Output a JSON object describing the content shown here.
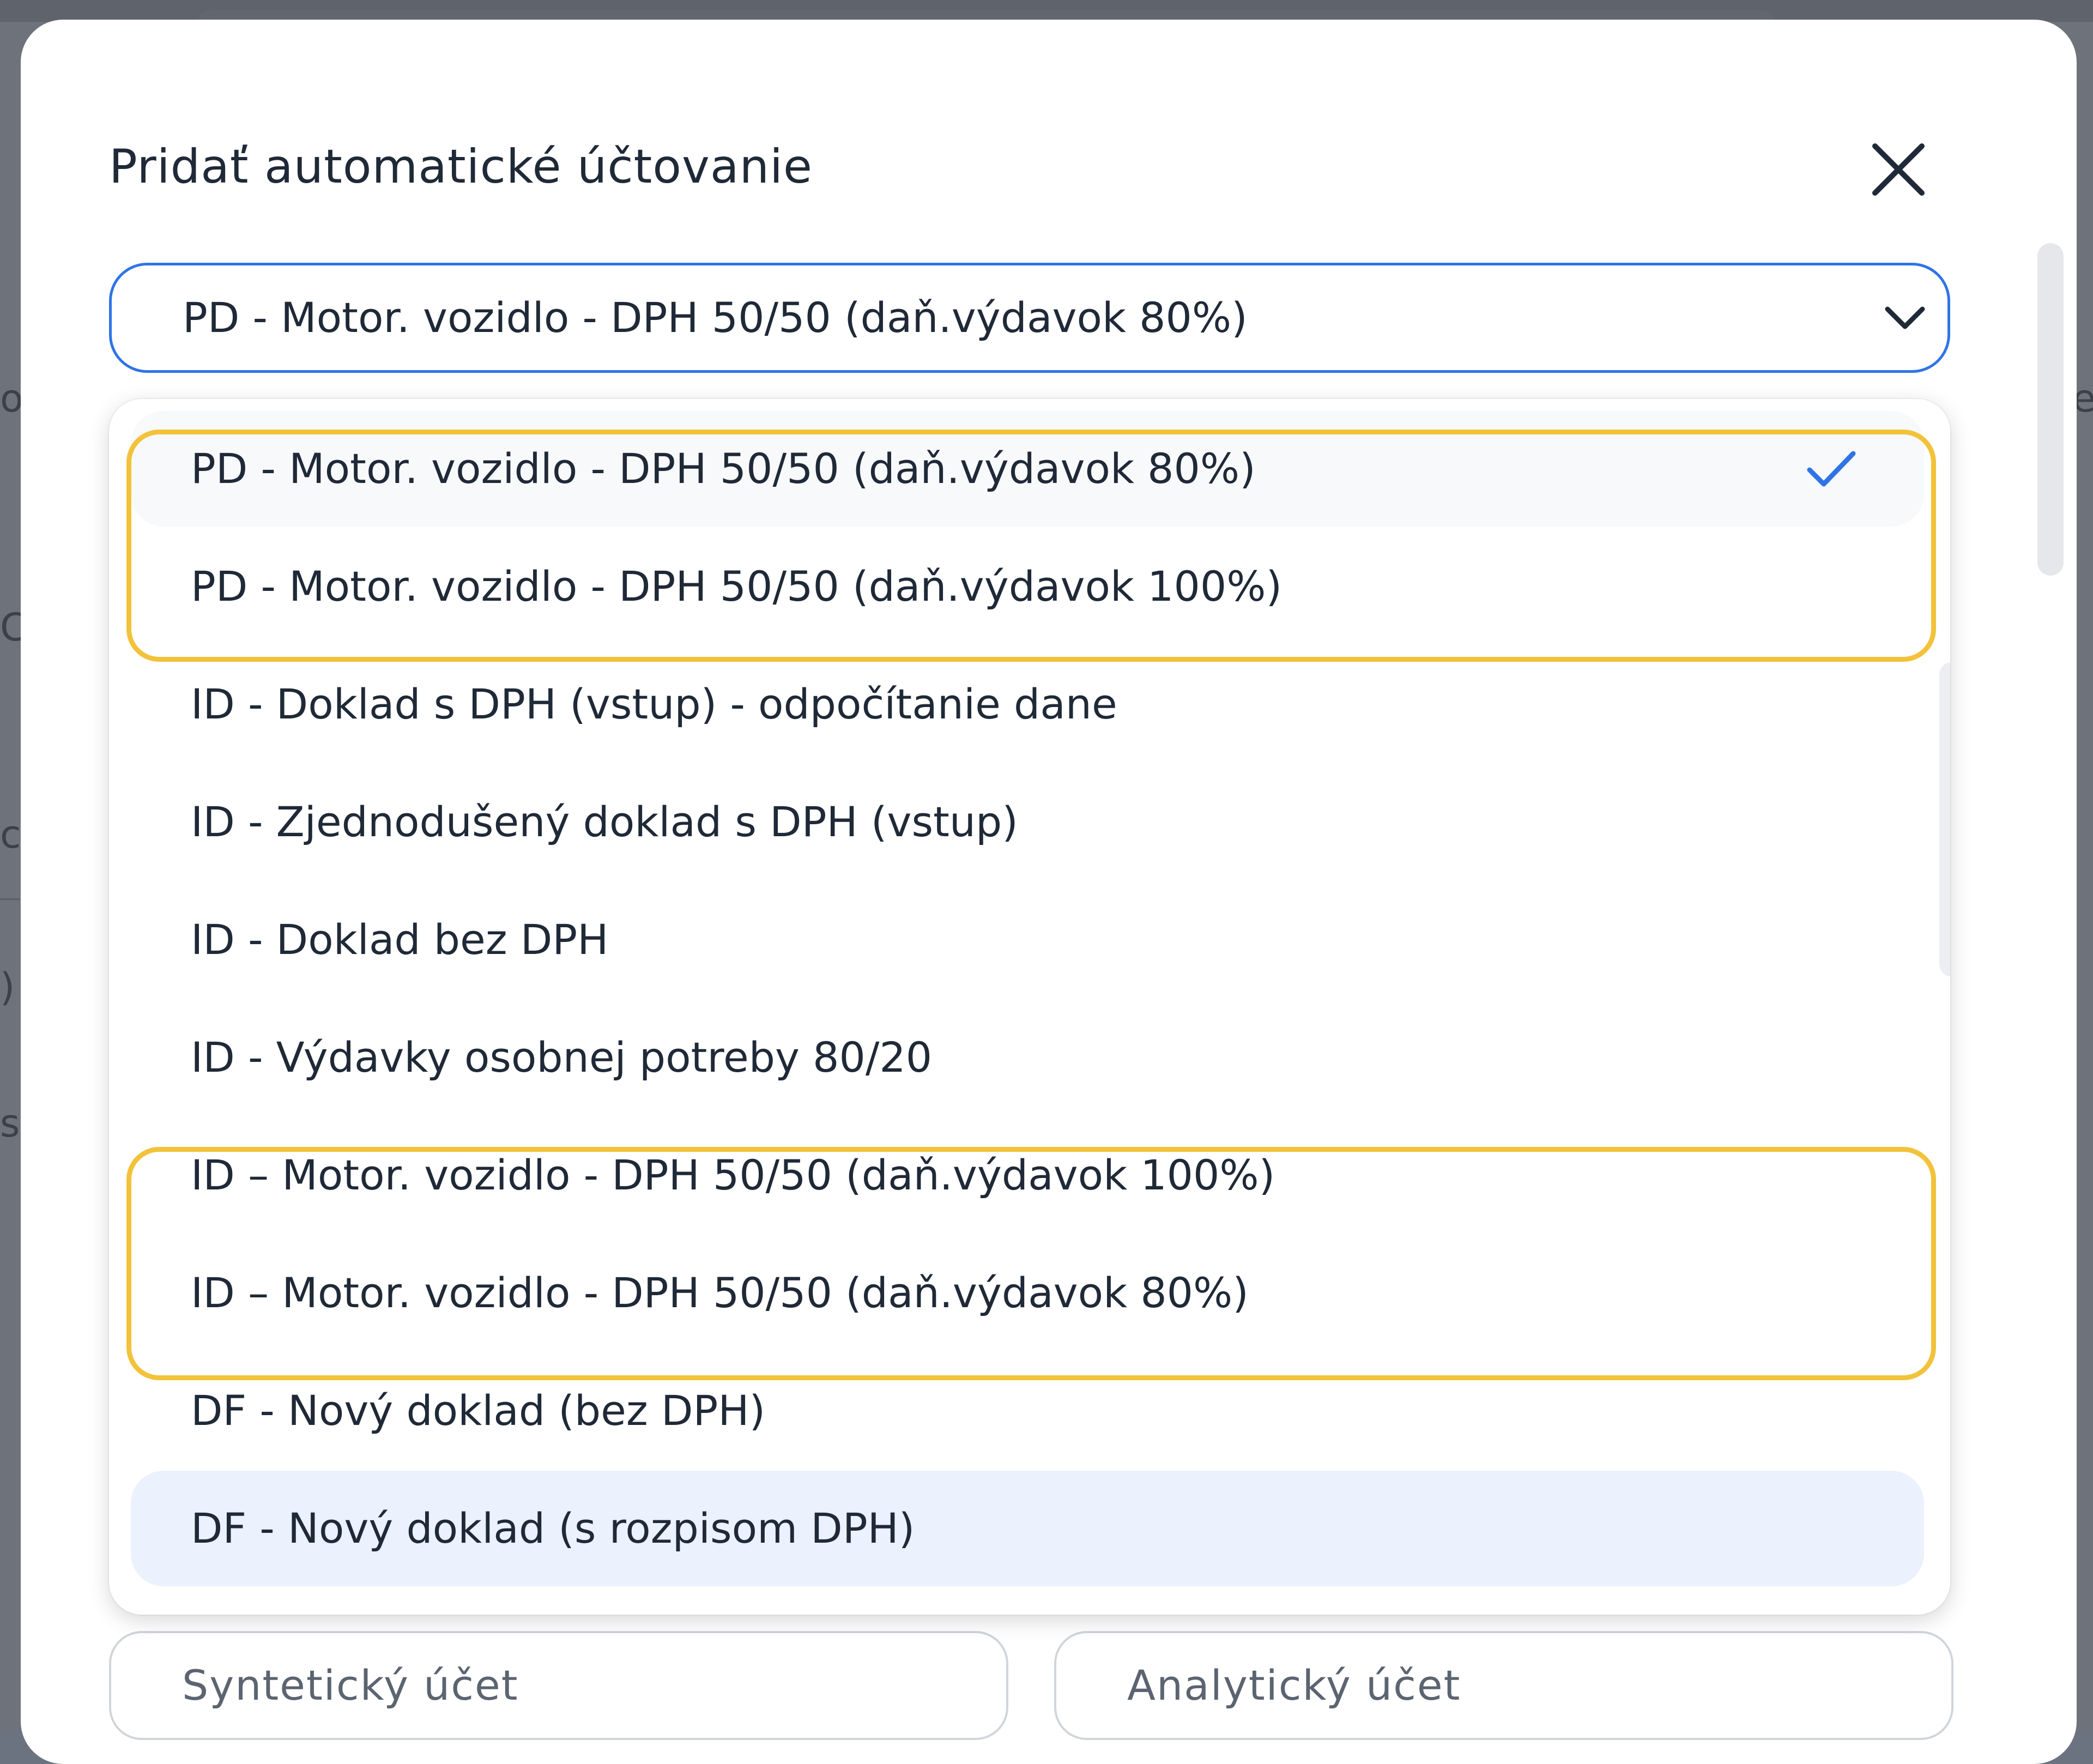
{
  "modal": {
    "title": "Pridať automatické účtovanie",
    "close_icon": "close-icon"
  },
  "select": {
    "value": "PD - Motor. vozidlo - DPH 50/50 (daň.výdavok 80%)",
    "chevron_icon": "chevron-down-icon"
  },
  "options": [
    {
      "label": "PD - Motor. vozidlo - DPH 50/50 (daň.výdavok 80%)",
      "selected": true,
      "checkmark_icon": "check-icon"
    },
    {
      "label": "PD - Motor. vozidlo - DPH 50/50 (daň.výdavok 100%)"
    },
    {
      "label": "ID - Doklad s DPH (vstup) - odpočítanie dane"
    },
    {
      "label": "ID - Zjednodušený doklad s DPH (vstup)"
    },
    {
      "label": "ID - Doklad bez DPH"
    },
    {
      "label": "ID - Výdavky osobnej potreby 80/20"
    },
    {
      "label": "ID – Motor. vozidlo - DPH 50/50 (daň.výdavok 100%)"
    },
    {
      "label": "ID – Motor. vozidlo - DPH 50/50 (daň.výdavok 80%)"
    },
    {
      "label": "DF - Nový doklad (bez DPH)"
    },
    {
      "label": "DF - Nový doklad (s rozpisom DPH)",
      "hovered": true
    }
  ],
  "accounts": {
    "synthetic_placeholder": "Syntetický účet",
    "analytic_placeholder": "Analytický účet"
  },
  "background": {
    "edge_chars_left": [
      "o",
      "C",
      "c",
      ")",
      "s"
    ],
    "edge_chars_right": [
      "e"
    ]
  },
  "colors": {
    "accent": "#2f74e6",
    "highlight": "#f2c23a",
    "selected_bg": "#f8f9fb",
    "hover_bg": "#ebf1fd",
    "overlay": "#6e727a"
  }
}
